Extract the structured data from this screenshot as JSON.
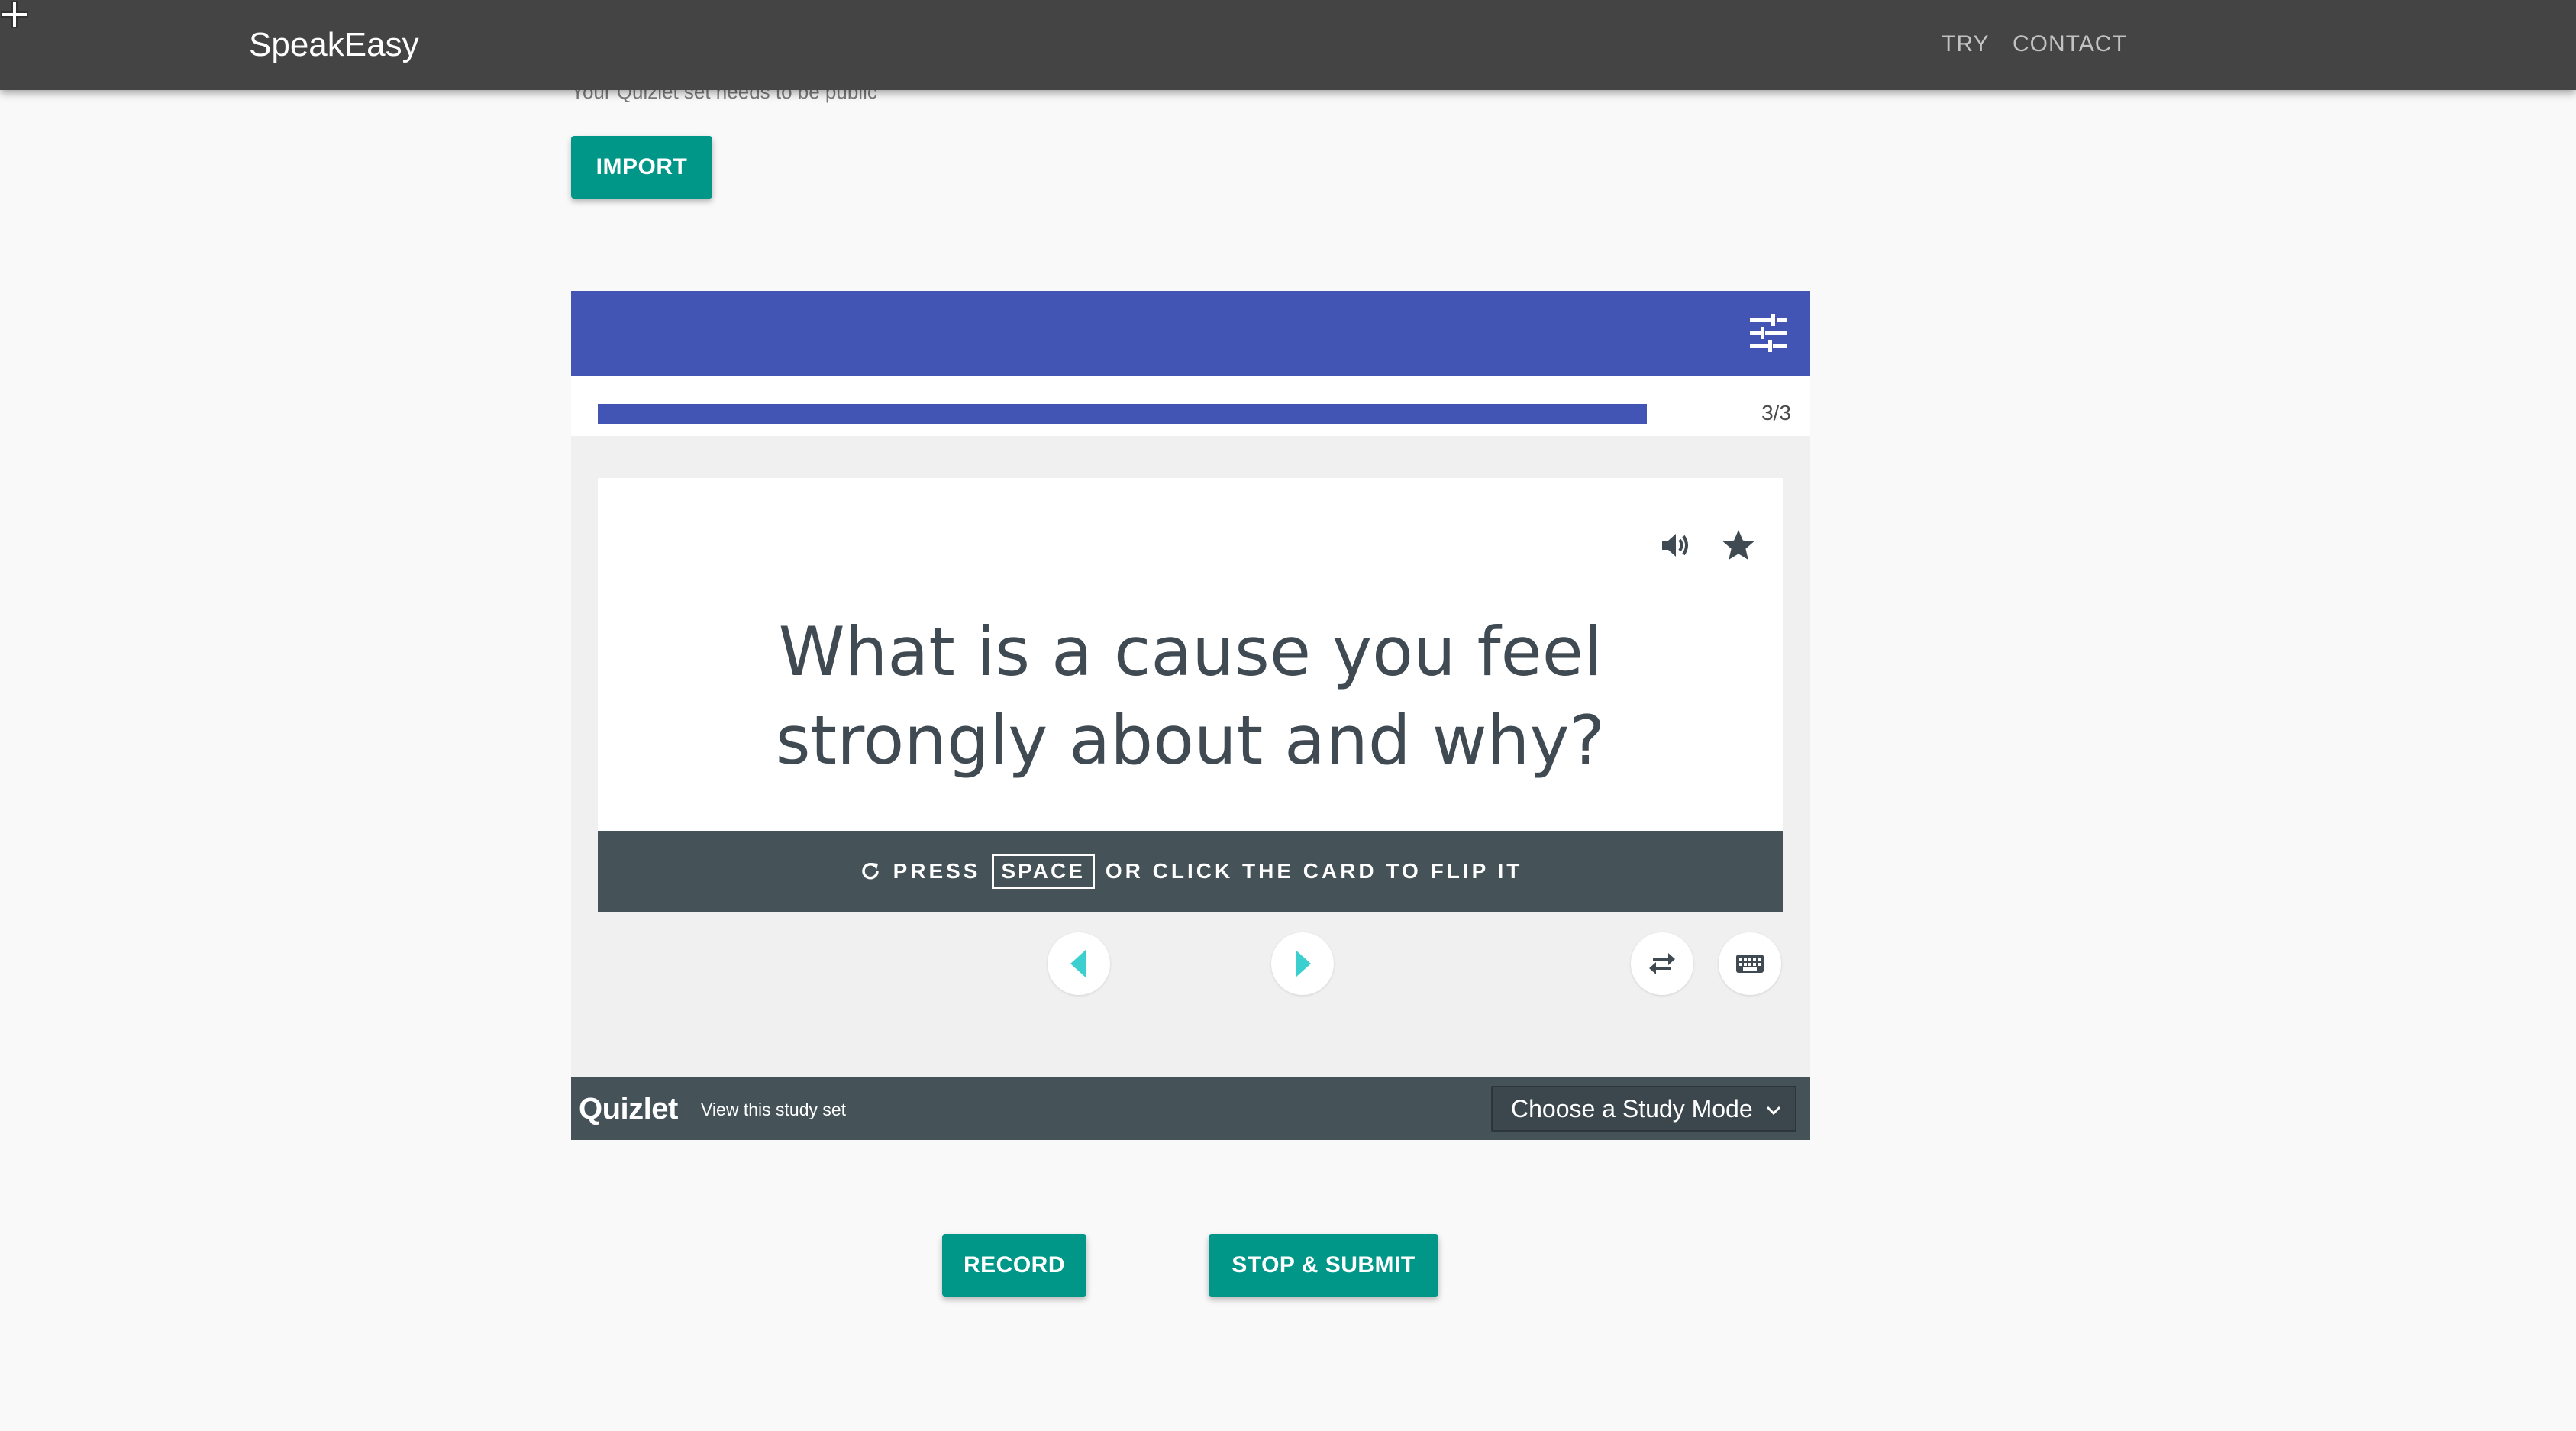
{
  "nav": {
    "brand": "SpeakEasy",
    "links": [
      "TRY",
      "CONTACT"
    ]
  },
  "import_section": {
    "hint": "Your Quizlet set needs to be public",
    "import_label": "IMPORT"
  },
  "embed": {
    "progress": {
      "count_text": "3/3",
      "fraction": 1.0
    },
    "card": {
      "text": "What is a cause you feel strongly about and why?",
      "icons": [
        "speaker-icon",
        "star-icon"
      ]
    },
    "flip_hint": {
      "before": "PRESS",
      "key": "SPACE",
      "after": "OR CLICK THE CARD TO FLIP IT"
    },
    "footer": {
      "logo": "Quizlet",
      "view_link": "View this study set",
      "study_mode": "Choose a Study Mode"
    }
  },
  "actions": {
    "record_label": "RECORD",
    "stop_label": "STOP & SUBMIT"
  },
  "colors": {
    "navbar": "#444444",
    "accent_teal": "#009688",
    "quizlet_blue": "#4255b4",
    "quizlet_dark": "#455358",
    "arrow_teal": "#3ccfcf"
  }
}
